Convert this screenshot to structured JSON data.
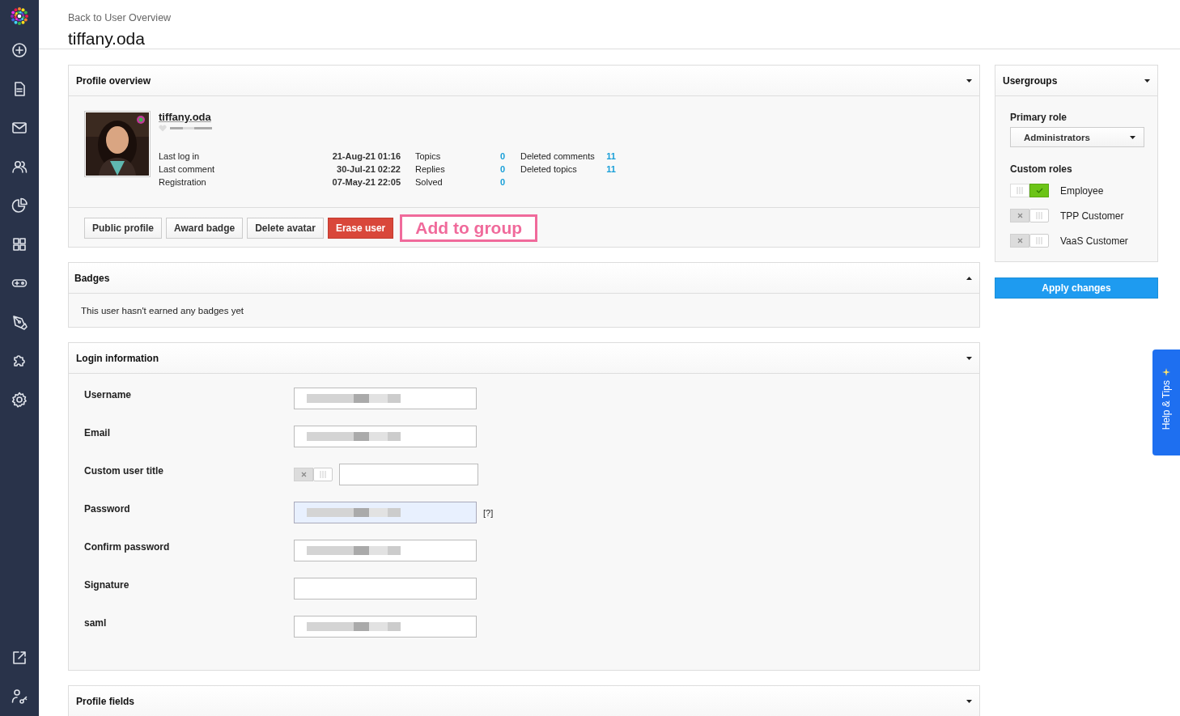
{
  "header": {
    "back_link": "Back to User Overview",
    "title": "tiffany.oda"
  },
  "profile_overview": {
    "title": "Profile overview",
    "caret_up": false,
    "username": "tiffany.oda",
    "dates": [
      {
        "label": "Last log in",
        "value": "21-Aug-21 01:16"
      },
      {
        "label": "Last comment",
        "value": "30-Jul-21 02:22"
      },
      {
        "label": "Registration",
        "value": "07-May-21 22:05"
      }
    ],
    "counts": [
      {
        "label": "Topics",
        "value": "0"
      },
      {
        "label": "Replies",
        "value": "0"
      },
      {
        "label": "Solved",
        "value": "0"
      }
    ],
    "deleted": [
      {
        "label": "Deleted comments",
        "value": "11"
      },
      {
        "label": "Deleted topics",
        "value": "11"
      }
    ],
    "buttons": [
      {
        "label": "Public profile",
        "kind": "default"
      },
      {
        "label": "Award badge",
        "kind": "default"
      },
      {
        "label": "Delete avatar",
        "kind": "default"
      },
      {
        "label": "Erase user",
        "kind": "danger"
      },
      {
        "label": "Add to group",
        "kind": "highlighted"
      }
    ]
  },
  "badges": {
    "title": "Badges",
    "caret_up": true,
    "message": "This user hasn't earned any badges yet"
  },
  "login_information": {
    "title": "Login information",
    "caret_up": false,
    "fields": [
      {
        "label": "Username",
        "kind": "blurred"
      },
      {
        "label": "Email",
        "kind": "blurred"
      },
      {
        "label": "Custom user title",
        "kind": "toggle",
        "on": false
      },
      {
        "label": "Password",
        "kind": "blurred",
        "autofilled": true,
        "help": "[?]"
      },
      {
        "label": "Confirm password",
        "kind": "blurred"
      },
      {
        "label": "Signature",
        "kind": "empty"
      },
      {
        "label": "saml",
        "kind": "blurred"
      }
    ]
  },
  "profile_fields": {
    "title": "Profile fields",
    "caret_up": false
  },
  "usergroups": {
    "title": "Usergroups",
    "caret_up": false,
    "primary_role_label": "Primary role",
    "primary_role": "Administrators",
    "custom_roles_label": "Custom roles",
    "roles": [
      {
        "name": "Employee",
        "on": true
      },
      {
        "name": "TPP Customer",
        "on": false
      },
      {
        "name": "VaaS Customer",
        "on": false
      }
    ],
    "apply_button": "Apply changes"
  },
  "help_tab": {
    "label": "Help & Tips"
  }
}
